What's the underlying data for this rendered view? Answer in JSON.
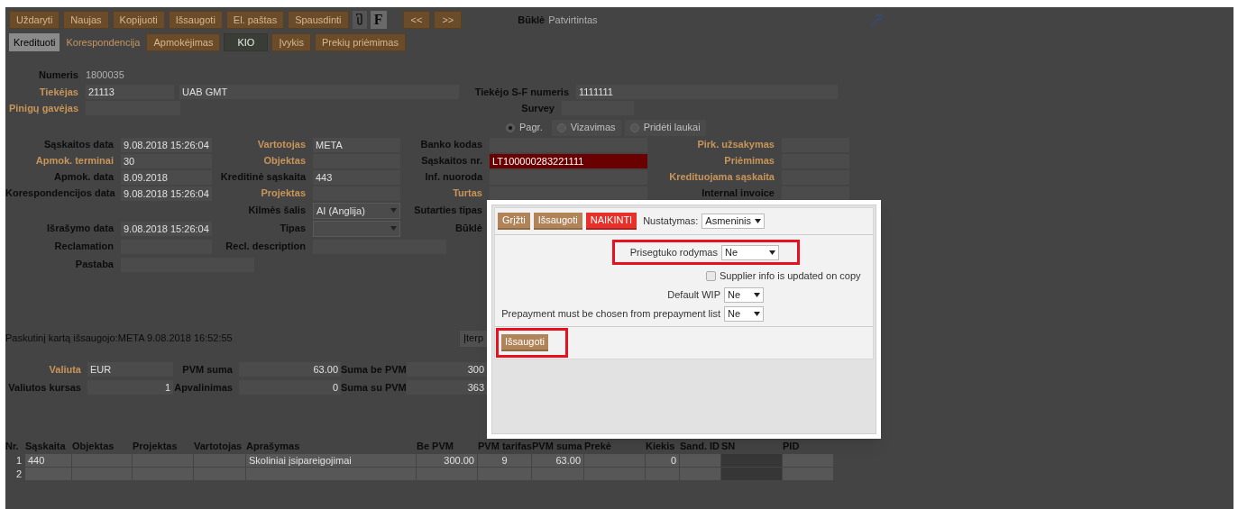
{
  "toolbar": {
    "buttons": [
      {
        "label": "Uždaryti"
      },
      {
        "label": "Naujas"
      },
      {
        "label": "Kopijuoti"
      },
      {
        "label": "Išsaugoti"
      },
      {
        "label": "El. paštas"
      },
      {
        "label": "Spausdinti"
      }
    ],
    "format_label": "F",
    "nav": [
      "<<",
      ">>"
    ],
    "status_label": "Būklė",
    "status_value": "Patvirtintas"
  },
  "tabs": [
    {
      "label": "Kredituoti",
      "kind": "tab",
      "selected": true,
      "disabled": false
    },
    {
      "label": "Korespondencija",
      "kind": "link",
      "selected": false,
      "disabled": false
    },
    {
      "label": "Apmokėjimas",
      "kind": "button",
      "selected": false,
      "disabled": false
    },
    {
      "label": "KIO",
      "kind": "button",
      "selected": false,
      "disabled": true
    },
    {
      "label": "Įvykis",
      "kind": "button",
      "selected": false,
      "disabled": false
    },
    {
      "label": "Prekių priėmimas",
      "kind": "button",
      "selected": false,
      "disabled": false
    }
  ],
  "header": {
    "number_label": "Numeris",
    "number": "1800035",
    "supplier_label": "Tiekėjas",
    "supplier_code": "21113",
    "supplier_name": "UAB GMT",
    "payee_label": "Pinigų gavėjas",
    "invoice_label": "Tiekėjo S-F numeris",
    "invoice_number": "1111111",
    "survey_label": "Survey"
  },
  "view_tabs": [
    {
      "label": "Pagr.",
      "selected": true
    },
    {
      "label": "Vizavimas",
      "selected": false
    },
    {
      "label": "Pridėti laukai",
      "selected": false
    }
  ],
  "grid": [
    {
      "left": {
        "label": "Sąskaitos data",
        "value": "9.08.2018 15:26:04",
        "kind": "text",
        "link": false
      },
      "middle": {
        "label": "Vartotojas",
        "value": "META",
        "kind": "text",
        "link": true
      },
      "right": {
        "label": "Banko kodas",
        "kind": "text",
        "link": false
      },
      "far_right": {
        "label": "Pirk. užsakymas",
        "kind": "text",
        "link": true
      }
    },
    {
      "left": {
        "label": "Apmok. terminai",
        "value": "30",
        "kind": "text",
        "link": true
      },
      "middle": {
        "label": "Objektas",
        "kind": "text",
        "link": true
      },
      "right": {
        "label": "Sąskaitos nr.",
        "value": "LT100000283221111",
        "kind": "error",
        "link": false
      },
      "far_right": {
        "label": "Priėmimas",
        "kind": "text",
        "link": true
      }
    },
    {
      "left": {
        "label": "Apmok. data",
        "value": "8.09.2018",
        "kind": "text",
        "link": false
      },
      "middle": {
        "label": "Kreditinė sąskaita",
        "value": "443",
        "kind": "text",
        "link": false
      },
      "right": {
        "label": "Inf. nuoroda",
        "kind": "text",
        "link": false
      },
      "far_right": {
        "label": "Kredituojama sąskaita",
        "kind": "text",
        "link": true
      }
    },
    {
      "left": {
        "label": "Korespondencijos data",
        "value": "9.08.2018 15:26:04",
        "kind": "text",
        "link": false
      },
      "middle": {
        "label": "Projektas",
        "kind": "text",
        "link": true
      },
      "right": {
        "label": "Turtas",
        "kind": "text",
        "link": true
      },
      "far_right": {
        "label": "Internal invoice",
        "kind": "text",
        "link": false
      }
    },
    {
      "middle": {
        "label": "Kilmės šalis",
        "value": "AI (Anglija)",
        "kind": "select",
        "link": false
      },
      "right": {
        "label": "Sutarties tipas",
        "kind": "hidden",
        "link": false
      }
    },
    {
      "left": {
        "label": "Išrašymo data",
        "value": "9.08.2018 15:26:04",
        "kind": "text",
        "link": false
      },
      "middle": {
        "label": "Tipas",
        "kind": "select",
        "link": false
      },
      "right": {
        "label": "Būklė",
        "kind": "hidden",
        "link": false
      }
    },
    {
      "left": {
        "label": "Reclamation",
        "kind": "text",
        "link": false
      },
      "middle": {
        "label": "Recl. description",
        "kind": "wide",
        "link": false
      }
    },
    {
      "left": {
        "label": "Pastaba",
        "kind": "wide",
        "link": false
      }
    }
  ],
  "saved_by": "Paskutinį kartą išsaugojo:META 9.08.2018 16:52:55",
  "insert_button": "Įterp",
  "totals": [
    [
      {
        "label": "Valiuta",
        "value": "EUR",
        "link": true
      },
      {
        "label": "PVM suma",
        "value": "63.00",
        "link": false
      },
      {
        "label": "Suma be PVM",
        "value": "300",
        "link": false
      }
    ],
    [
      {
        "label": "Valiutos kursas",
        "value": "1",
        "link": false
      },
      {
        "label": "Apvalinimas",
        "value": "0",
        "link": false
      },
      {
        "label": "Suma su PVM",
        "value": "363",
        "link": false
      }
    ]
  ],
  "table": {
    "columns": [
      {
        "label": "Nr.",
        "kind": "number"
      },
      {
        "label": "Sąskaita",
        "kind": "text"
      },
      {
        "label": "Objektas",
        "kind": "text"
      },
      {
        "label": "Projektas",
        "kind": "text"
      },
      {
        "label": "Vartotojas",
        "kind": "text"
      },
      {
        "label": "Aprašymas",
        "kind": "text"
      },
      {
        "label": "Be PVM",
        "kind": "number"
      },
      {
        "label": "PVM tarifas",
        "kind": "center"
      },
      {
        "label": "PVM suma",
        "kind": "number"
      },
      {
        "label": "Prekė",
        "kind": "text"
      },
      {
        "label": "Kiekis",
        "kind": "number"
      },
      {
        "label": "Sand. ID",
        "kind": "text"
      },
      {
        "label": "SN",
        "kind": "text"
      },
      {
        "label": "PID",
        "kind": "text"
      }
    ],
    "rows": [
      [
        "1",
        "440",
        null,
        null,
        null,
        "Skoliniai įsipareigojimai",
        "300.00",
        "9",
        "63.00",
        null,
        "0",
        null,
        null,
        null
      ],
      [
        "2",
        null,
        null,
        null,
        null,
        null,
        null,
        null,
        null,
        null,
        null,
        null,
        null,
        null
      ]
    ]
  },
  "dialog": {
    "buttons": [
      {
        "label": "Grįžti",
        "kind": "plain"
      },
      {
        "label": "Išsaugoti",
        "kind": "plain"
      },
      {
        "label": "NAIKINTI",
        "kind": "danger"
      }
    ],
    "setting_label": "Nustatymas:",
    "setting_value": "Asmeninis",
    "rows": [
      {
        "kind": "select",
        "label": "Prisegtuko rodymas",
        "value": "Ne",
        "highlighted": true
      },
      {
        "kind": "checkbox",
        "label": "Supplier info is updated on copy",
        "checked": false,
        "highlighted": false
      },
      {
        "kind": "select",
        "label": "Default WIP",
        "value": "Ne",
        "highlighted": false
      },
      {
        "kind": "select",
        "label": "Prepayment must be chosen from prepayment list",
        "value": "Ne",
        "highlighted": false
      }
    ],
    "save_button": {
      "label": "Išsaugoti",
      "highlighted": true
    }
  }
}
